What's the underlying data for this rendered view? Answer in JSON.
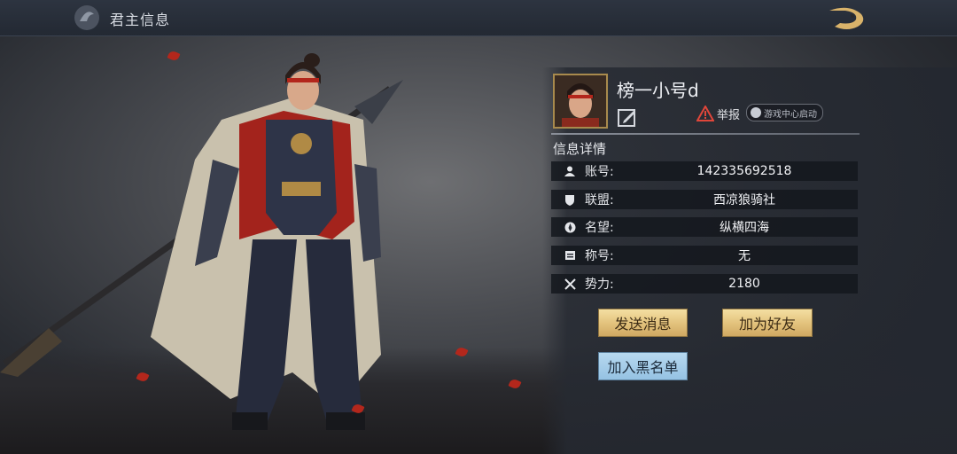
{
  "header": {
    "title": "君主信息"
  },
  "profile": {
    "name": "榜一小号d",
    "report_label": "举报",
    "launch_badge": "游戏中心启动"
  },
  "details": {
    "section_title": "信息详情",
    "rows": [
      {
        "label": "账号:",
        "value": "142335692518",
        "icon": "person-icon"
      },
      {
        "label": "联盟:",
        "value": "西凉狼骑社",
        "icon": "shield-icon"
      },
      {
        "label": "名望:",
        "value": "纵横四海",
        "icon": "compass-icon"
      },
      {
        "label": "称号:",
        "value": "无",
        "icon": "scroll-icon"
      },
      {
        "label": "势力:",
        "value": "2180",
        "icon": "crossed-swords-icon"
      }
    ]
  },
  "actions": {
    "send_message": "发送消息",
    "add_friend": "加为好友",
    "add_blacklist": "加入黑名单"
  },
  "colors": {
    "gold_button": "#e2c17b",
    "blue_button": "#95c2e3",
    "panel_bg": "#242832",
    "warning": "#e0463a"
  }
}
